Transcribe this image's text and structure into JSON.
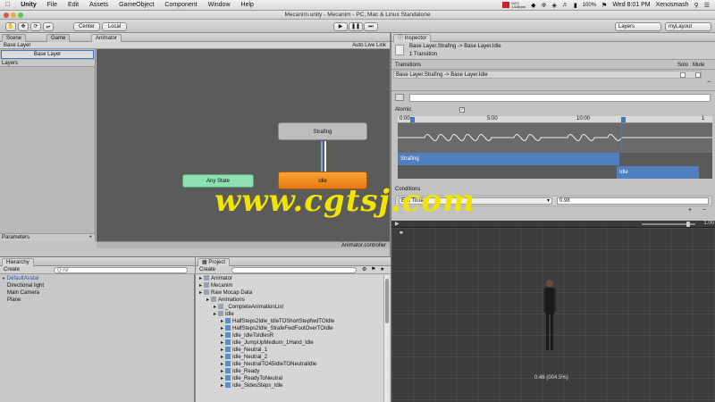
{
  "menubar": {
    "apple": "",
    "items": [
      "Unity",
      "File",
      "Edit",
      "Assets",
      "GameObject",
      "Component",
      "Window",
      "Help"
    ],
    "temp": "64°C",
    "rpm": "1416rpm",
    "battery": "100%",
    "time": "Wed 8:01 PM",
    "user": "Xenosmash"
  },
  "window_title": "Mecanim.unity - Mecanim - PC, Mac & Linux Standalone",
  "toolbar": {
    "center": "Center",
    "local": "Local",
    "layers": "Layers",
    "layout": "myLayout"
  },
  "tabs": {
    "scene": "Scene",
    "game": "Game",
    "animator": "Animator",
    "inspector": "Inspector",
    "hierarchy": "Hierarchy",
    "project": "Project"
  },
  "animator": {
    "breadcrumb": "Base Layer",
    "auto_live": "Auto Live Link",
    "layer_item": "Base Layer",
    "layers_label": "Layers",
    "parameters_label": "Parameters",
    "controller_name": "Animator.controller",
    "states": {
      "strafing": "Strafing",
      "idle": "Idle",
      "any_state": "Any State"
    }
  },
  "inspector": {
    "title": "Base Layer.Strafing -> Base Layer.Idle",
    "subtitle": "1 Transition",
    "transitions_label": "Transitions",
    "solo": "Solo",
    "mute": "Mute",
    "transition_row": "Base Layer.Strafing -> Base Layer.Idle",
    "atomic": "Atomic",
    "timeline_ticks": [
      "0:00",
      "5:00",
      "10:00",
      "1"
    ],
    "strafing_bar": "Strafing",
    "idle_bar": "Idle",
    "conditions_label": "Conditions",
    "condition_param": "Exit Time",
    "condition_value": "0.98",
    "preview_speed": "1.00",
    "preview_time": "0:46 (004.5%)"
  },
  "hierarchy": {
    "create": "Create",
    "search_placeholder": "Q All",
    "items": [
      "DefaultAvatar",
      "Directional light",
      "Main Camera",
      "Plane"
    ]
  },
  "project": {
    "create": "Create",
    "items": [
      {
        "label": "Animator",
        "indent": 0
      },
      {
        "label": "Mecanim",
        "indent": 0
      },
      {
        "label": "Raw Mocap Data",
        "indent": 0
      },
      {
        "label": "Animations",
        "indent": 1
      },
      {
        "label": "_CompleteAnimationList",
        "indent": 2
      },
      {
        "label": "Idle",
        "indent": 2
      },
      {
        "label": "HalfSteps2Idle_IdleTOShortStepfwdTOIdle",
        "indent": 3
      },
      {
        "label": "HalfSteps2Idle_StrafeFwdFootOverTOIdle",
        "indent": 3
      },
      {
        "label": "Idle_IdleToIdlesR",
        "indent": 3
      },
      {
        "label": "Idle_JumpUpMedium_1Hand_Idle",
        "indent": 3
      },
      {
        "label": "Idle_Neutral_1",
        "indent": 3
      },
      {
        "label": "Idle_Neutral_2",
        "indent": 3
      },
      {
        "label": "Idle_NeutralTO45IdleTONeutralIdle",
        "indent": 3
      },
      {
        "label": "Idle_Ready",
        "indent": 3
      },
      {
        "label": "Idle_ReadyToNeutral",
        "indent": 3
      },
      {
        "label": "Idle_SidesSteps_Idle",
        "indent": 3
      }
    ]
  },
  "watermark": "www.cgtsj.com",
  "colors": {
    "strafing_state": "#bdbdbd",
    "idle_state": "#f08a1a",
    "any_state": "#8ee0b0",
    "accent": "#3d78c9"
  }
}
